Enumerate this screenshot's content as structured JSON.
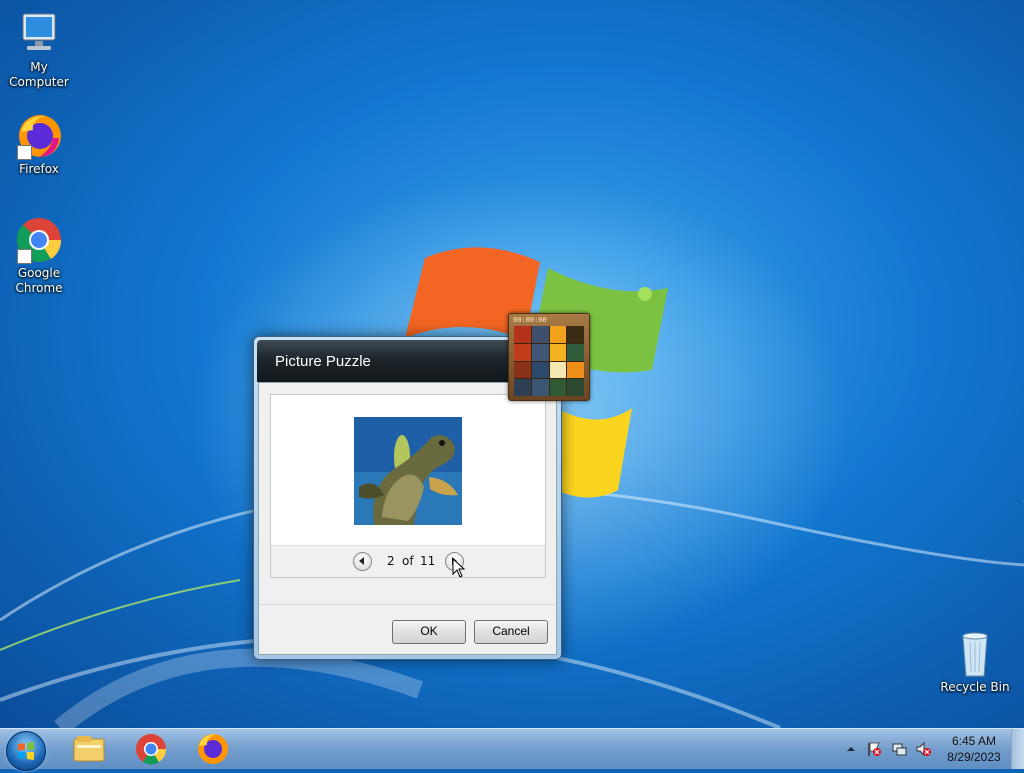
{
  "desktop": {
    "icons": [
      {
        "label": "My Computer",
        "icon": "computer-icon"
      },
      {
        "label": "Firefox",
        "icon": "firefox-icon"
      },
      {
        "label": "Google Chrome",
        "icon": "chrome-icon"
      }
    ],
    "recycle_bin": {
      "label": "Recycle Bin",
      "icon": "recycle-bin-icon"
    }
  },
  "dialog": {
    "title": "Picture Puzzle",
    "picture": {
      "icon": "sea-turtle-image"
    },
    "pager": {
      "current": "2",
      "of_label": "of",
      "total": "11"
    },
    "buttons": {
      "ok": "OK",
      "cancel": "Cancel"
    }
  },
  "gadget": {
    "timer": "00:00:00",
    "name": "picture-puzzle-gadget"
  },
  "taskbar": {
    "pinned": [
      "file-explorer-icon",
      "chrome-icon",
      "firefox-icon"
    ],
    "tray": [
      "show-hidden-icons-icon",
      "action-center-flag-icon",
      "network-icon",
      "volume-muted-icon"
    ],
    "time": "6:45 AM",
    "date": "8/29/2023"
  },
  "colors": {
    "desktop_bg": "#0f63b8",
    "dialog_title_bg": "#1e262c",
    "taskbar": "#7aa0cc"
  }
}
